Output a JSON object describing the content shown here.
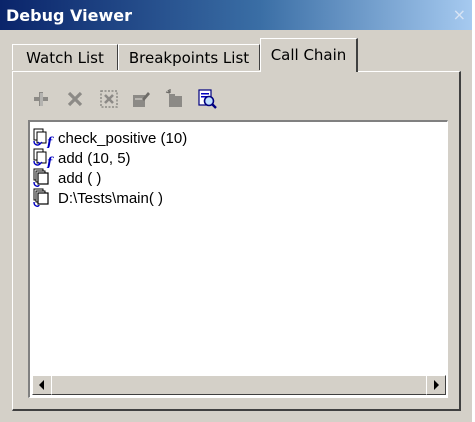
{
  "window": {
    "title": "Debug Viewer",
    "close_glyph": "×"
  },
  "tabs": [
    {
      "label": "Watch List",
      "active": false
    },
    {
      "label": "Breakpoints List",
      "active": false
    },
    {
      "label": "Call Chain",
      "active": true
    }
  ],
  "toolbar": {
    "buttons": [
      {
        "icon": "add-icon",
        "enabled": false
      },
      {
        "icon": "delete-icon",
        "enabled": false
      },
      {
        "icon": "delete-all-icon",
        "enabled": false
      },
      {
        "icon": "modify-icon",
        "enabled": false
      },
      {
        "icon": "new-folder-icon",
        "enabled": false
      },
      {
        "icon": "quick-watch-icon",
        "enabled": true
      }
    ]
  },
  "call_chain": [
    {
      "label": "check_positive (10)",
      "icon": "function-call-icon"
    },
    {
      "label": "add (10, 5)",
      "icon": "function-call-icon"
    },
    {
      "label": "add ( )",
      "icon": "test-call-icon"
    },
    {
      "label": "D:\\Tests\\main( )",
      "icon": "test-call-icon"
    }
  ],
  "colors": {
    "titlebar_start": "#0a246a",
    "titlebar_end": "#a6caf0",
    "face": "#d4d0c8",
    "list_bg": "#ffffff",
    "icon_blue": "#0000c0"
  }
}
